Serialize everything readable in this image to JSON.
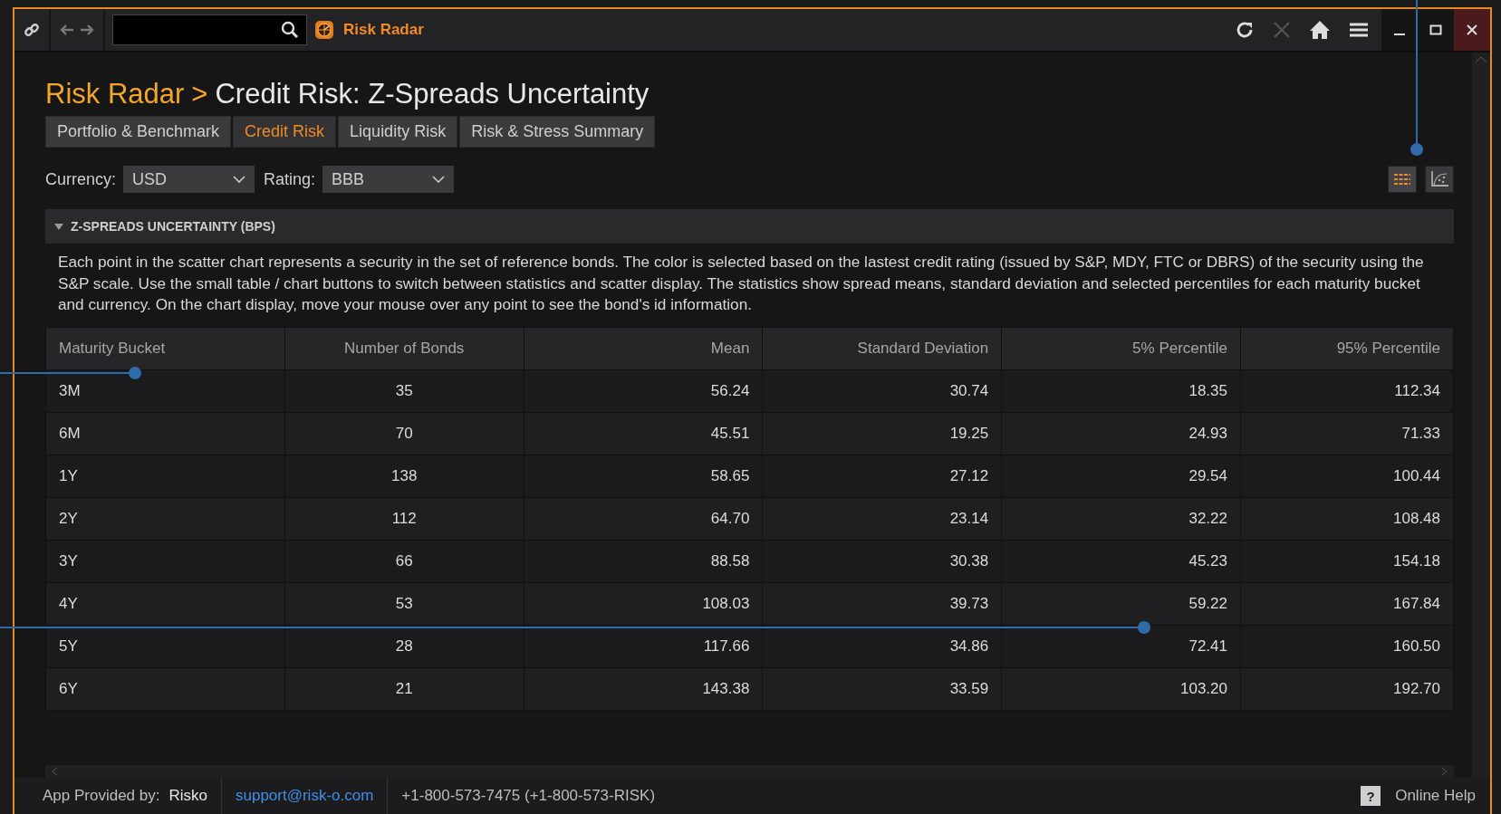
{
  "toolbar": {
    "app_name": "Risk Radar"
  },
  "title": {
    "app": "Risk Radar",
    "separator": ">",
    "page": "Credit Risk: Z-Spreads Uncertainty"
  },
  "tabs": [
    {
      "label": "Portfolio & Benchmark",
      "selected": false
    },
    {
      "label": "Credit Risk",
      "selected": true
    },
    {
      "label": "Liquidity Risk",
      "selected": false
    },
    {
      "label": "Risk & Stress Summary",
      "selected": false
    }
  ],
  "filters": [
    {
      "label": "Currency:",
      "value": "USD"
    },
    {
      "label": "Rating:",
      "value": "BBB"
    }
  ],
  "view_buttons": [
    {
      "kind": "table",
      "selected": true
    },
    {
      "kind": "chart",
      "selected": false
    }
  ],
  "section": {
    "title": "Z-SPREADS UNCERTAINTY (BPS)",
    "expanded": true,
    "description": "Each point in the scatter chart represents a security in the set of reference bonds. The color is selected based on the lastest credit rating (issued by S&P, MDY, FTC or DBRS) of the security using the S&P scale. Use the small table / chart buttons to switch between statistics and scatter display. The statistics show spread means, standard deviation and selected percentiles for each maturity bucket and currency. On the chart display, move your mouse over any point to see the bond's id information."
  },
  "table": {
    "columns": [
      "Maturity Bucket",
      "Number of Bonds",
      "Mean",
      "Standard Deviation",
      "5% Percentile",
      "95% Percentile"
    ],
    "rows": [
      [
        "3M",
        "35",
        "56.24",
        "30.74",
        "18.35",
        "112.34"
      ],
      [
        "6M",
        "70",
        "45.51",
        "19.25",
        "24.93",
        "71.33"
      ],
      [
        "1Y",
        "138",
        "58.65",
        "27.12",
        "29.54",
        "100.44"
      ],
      [
        "2Y",
        "112",
        "64.70",
        "23.14",
        "32.22",
        "108.48"
      ],
      [
        "3Y",
        "66",
        "88.58",
        "30.38",
        "45.23",
        "154.18"
      ],
      [
        "4Y",
        "53",
        "108.03",
        "39.73",
        "59.22",
        "167.84"
      ],
      [
        "5Y",
        "28",
        "117.66",
        "34.86",
        "72.41",
        "160.50"
      ],
      [
        "6Y",
        "21",
        "143.38",
        "33.59",
        "103.20",
        "192.70"
      ]
    ]
  },
  "footer": {
    "provider_label": "App Provided by:",
    "provider": "Risko",
    "email": "support@risk-o.com",
    "phone": "+1-800-573-7475 (+1-800-573-RISK)",
    "help_icon": "?",
    "help": "Online Help"
  }
}
